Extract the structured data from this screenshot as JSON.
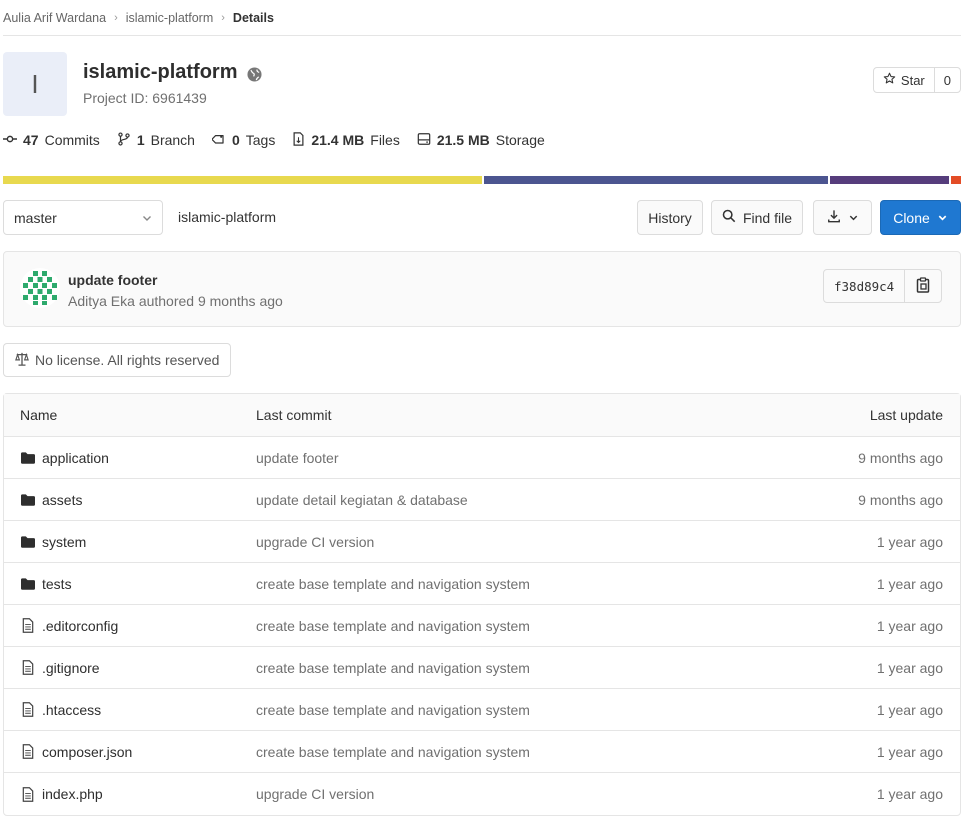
{
  "breadcrumb": {
    "items": [
      "Aulia Arif Wardana",
      "islamic-platform"
    ],
    "current": "Details"
  },
  "project": {
    "avatar_letter": "I",
    "name": "islamic-platform",
    "id_text": "Project ID: 6961439",
    "star_label": "Star",
    "star_count": "0"
  },
  "stats": {
    "commits_count": "47",
    "commits_label": "Commits",
    "branch_count": "1",
    "branch_label": "Branch",
    "tags_count": "0",
    "tags_label": "Tags",
    "files_size": "21.4 MB",
    "files_label": "Files",
    "storage_size": "21.5 MB",
    "storage_label": "Storage"
  },
  "language_bar": [
    {
      "color": "#e8d94f",
      "share": 50.3
    },
    {
      "color": "#4c5590",
      "share": 36.1
    },
    {
      "color": "#563d7c",
      "share": 12.5
    },
    {
      "color": "#e34c26",
      "share": 1.1
    }
  ],
  "toolbar": {
    "branch": "master",
    "path": "islamic-platform",
    "history": "History",
    "find_file": "Find file",
    "clone": "Clone"
  },
  "last_commit": {
    "title": "update footer",
    "meta": "Aditya Eka authored 9 months ago",
    "sha": "f38d89c4"
  },
  "license": "No license. All rights reserved",
  "tree": {
    "headers": {
      "name": "Name",
      "commit": "Last commit",
      "update": "Last update"
    },
    "rows": [
      {
        "type": "folder",
        "name": "application",
        "commit": "update footer",
        "update": "9 months ago"
      },
      {
        "type": "folder",
        "name": "assets",
        "commit": "update detail kegiatan & database",
        "update": "9 months ago"
      },
      {
        "type": "folder",
        "name": "system",
        "commit": "upgrade CI version",
        "update": "1 year ago"
      },
      {
        "type": "folder",
        "name": "tests",
        "commit": "create base template and navigation system",
        "update": "1 year ago"
      },
      {
        "type": "file",
        "name": ".editorconfig",
        "commit": "create base template and navigation system",
        "update": "1 year ago"
      },
      {
        "type": "file",
        "name": ".gitignore",
        "commit": "create base template and navigation system",
        "update": "1 year ago"
      },
      {
        "type": "file",
        "name": ".htaccess",
        "commit": "create base template and navigation system",
        "update": "1 year ago"
      },
      {
        "type": "file",
        "name": "composer.json",
        "commit": "create base template and navigation system",
        "update": "1 year ago"
      },
      {
        "type": "file",
        "name": "index.php",
        "commit": "upgrade CI version",
        "update": "1 year ago"
      }
    ]
  },
  "colors": {
    "primary": "#1f78d1",
    "border": "#e5e5e5"
  }
}
